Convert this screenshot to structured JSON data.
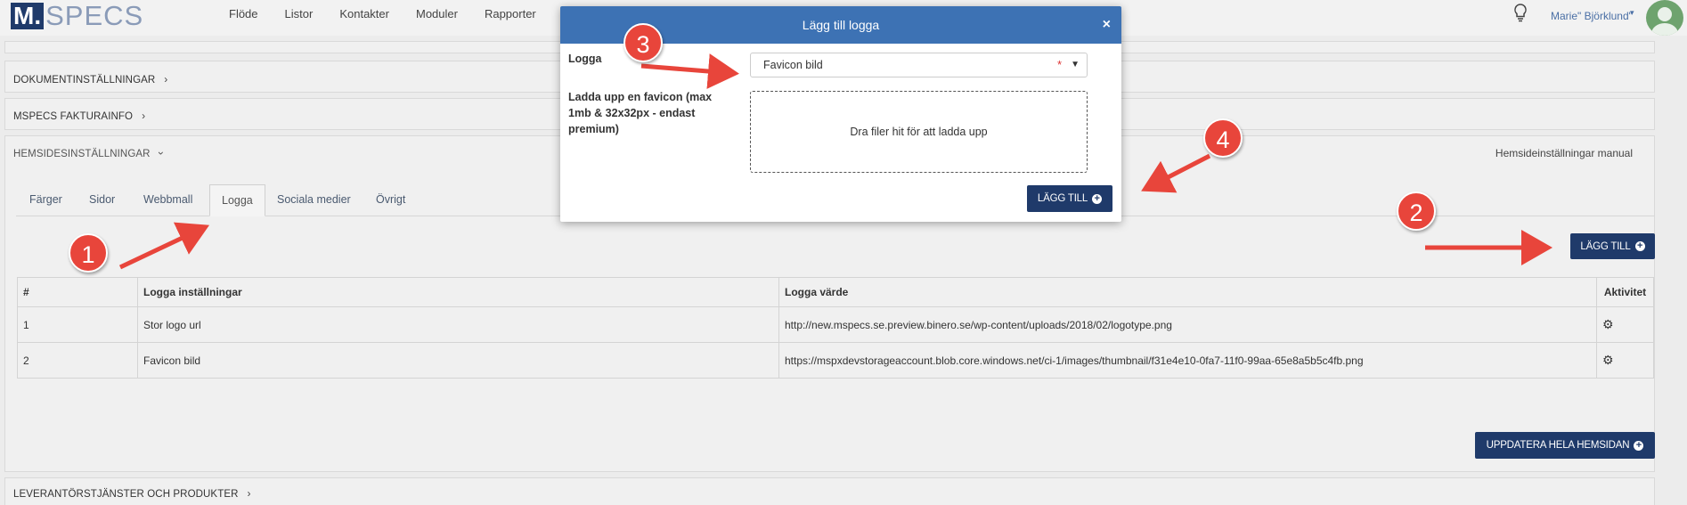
{
  "brand": {
    "logo_box": "M.",
    "logo_text": "SPECS"
  },
  "nav": {
    "items": [
      "Flöde",
      "Listor",
      "Kontakter",
      "Moduler",
      "Rapporter"
    ]
  },
  "user": {
    "name": "Marie\" Björklund\"",
    "caret": "▾"
  },
  "sections": {
    "dokument": "DOKUMENTINSTÄLLNINGAR",
    "faktura": "MSPECS FAKTURAINFO",
    "hemsida": "HEMSIDESINSTÄLLNINGAR",
    "leverantor": "LEVERANTÖRSTJÄNSTER OCH PRODUKTER",
    "manual_link": "Hemsideinställningar manual"
  },
  "tabs": [
    "Färger",
    "Sidor",
    "Webbmall",
    "Logga",
    "Sociala medier",
    "Övrigt"
  ],
  "active_tab": "Logga",
  "buttons": {
    "add": "LÄGG TILL",
    "update_site": "UPPDATERA HELA HEMSIDAN"
  },
  "table": {
    "headers": [
      "#",
      "Logga inställningar",
      "Logga värde",
      "Aktivitet"
    ],
    "rows": [
      [
        "1",
        "Stor logo url",
        "http://new.mspecs.se.preview.binero.se/wp-content/uploads/2018/02/logotype.png"
      ],
      [
        "2",
        "Favicon bild",
        "https://mspxdevstorageaccount.blob.core.windows.net/ci-1/images/thumbnail/f31e4e10-0fa7-11f0-99aa-65e8a5b5c4fb.png"
      ]
    ]
  },
  "modal": {
    "title": "Lägg till logga",
    "close": "×",
    "logga_label": "Logga",
    "select_value": "Favicon bild",
    "required_mark": "*",
    "upload_label": "Ladda upp en favicon (max 1mb & 32x32px - endast premium)",
    "dropzone_text": "Dra filer hit för att ladda upp",
    "submit": "LÄGG TILL"
  },
  "annotations": [
    "1",
    "2",
    "3",
    "4"
  ],
  "colors": {
    "primary_dark": "#1f3a6a",
    "modal_header": "#3d72b4",
    "annotation": "#e8453b"
  },
  "icons": {
    "bulb": "lightbulb-icon",
    "gear": "gear-icon",
    "chevron": "chevron-right-icon",
    "plus": "plus-circle-icon"
  }
}
